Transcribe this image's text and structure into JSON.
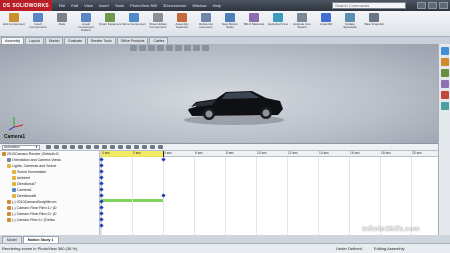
{
  "app": {
    "logo": "SOLIDWORKS",
    "logo_prefix": "DS"
  },
  "menus": [
    "File",
    "Edit",
    "View",
    "Insert",
    "Tools",
    "PhotoView 360",
    "3Dconnexion",
    "Window",
    "Help"
  ],
  "search": {
    "placeholder": "Search Commands"
  },
  "ribbon": [
    {
      "label": "Edit Component",
      "color": "#c9902d"
    },
    {
      "label": "Insert Components",
      "color": "#5a86c5"
    },
    {
      "label": "Mate",
      "color": "#7a7f88"
    },
    {
      "label": "Linear Component Pattern",
      "color": "#5a86c5"
    },
    {
      "label": "Smart Fasteners",
      "color": "#6e9a4e"
    },
    {
      "label": "Move Component",
      "color": "#4f8bc9"
    },
    {
      "label": "Show Hidden Components",
      "color": "#8a8f98"
    },
    {
      "label": "Assembly Features",
      "color": "#c46a3a"
    },
    {
      "label": "Reference Geometry",
      "color": "#6f86a8"
    },
    {
      "label": "New Motion Study",
      "color": "#4c7fb8"
    },
    {
      "label": "Bill of Materials",
      "color": "#8c6bb0"
    },
    {
      "label": "Exploded View",
      "color": "#3f9ac0"
    },
    {
      "label": "Explode Line Sketch",
      "color": "#7a8794"
    },
    {
      "label": "Instant3D",
      "color": "#3f6fd0"
    },
    {
      "label": "Update Speedpak",
      "color": "#5b8fb0"
    },
    {
      "label": "Take Snapshot",
      "color": "#6a7686"
    }
  ],
  "tabs": [
    "Assembly",
    "Layout",
    "Sketch",
    "Evaluate",
    "Render Tools",
    "Office Products",
    "Cables"
  ],
  "viewport": {
    "label": "Camera1"
  },
  "animation": {
    "mode": "Animation",
    "tree": [
      {
        "label": "2010Camaro Render (Default<D",
        "indent": 0,
        "color": "#c9902d"
      },
      {
        "label": "Orientation and Camera Views",
        "indent": 1,
        "color": "#6f86a8"
      },
      {
        "label": "Lights, Cameras and Scene",
        "indent": 1,
        "color": "#e2b43c"
      },
      {
        "label": "Scene Illumination",
        "indent": 2,
        "color": "#e2b43c"
      },
      {
        "label": "Ambient",
        "indent": 2,
        "color": "#e2b43c"
      },
      {
        "label": "Directional7",
        "indent": 2,
        "color": "#e2b43c"
      },
      {
        "label": "Camera1",
        "indent": 2,
        "color": "#5a86c5"
      },
      {
        "label": "Directional8",
        "indent": 2,
        "color": "#e2b43c"
      },
      {
        "label": "(-) 2010CamaroBodyMirror<",
        "indent": 1,
        "color": "#c9902d"
      },
      {
        "label": "(-) Camaro Rear Rim<1> (D",
        "indent": 1,
        "color": "#c9902d"
      },
      {
        "label": "(-) Camaro Rear Rim<2> (D",
        "indent": 1,
        "color": "#c9902d"
      },
      {
        "label": "(-) Camaro Rim<1> (Defau",
        "indent": 1,
        "color": "#c9902d"
      }
    ],
    "ruler": [
      "0 sec",
      "2 sec",
      "4 sec",
      "6 sec",
      "8 sec",
      "10 sec",
      "12 sec",
      "14 sec",
      "16 sec",
      "18 sec",
      "20 sec"
    ]
  },
  "bottom_tabs": [
    "Model",
    "Motion Study 1"
  ],
  "status": {
    "left": "Rendering scene in PhotoView 360 (38 %)",
    "defined": "Under Defined",
    "editing": "Editing Assembly"
  },
  "watermark": "InfiniteSkills.com"
}
